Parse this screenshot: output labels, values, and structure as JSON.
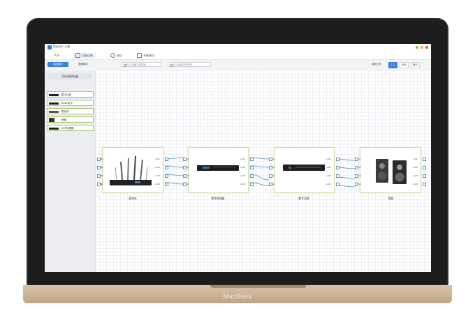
{
  "device": {
    "brand": "MacBook"
  },
  "app": {
    "title": "Digisyn 上线"
  },
  "tabs": [
    {
      "label": "A/A",
      "icon": "home-icon"
    },
    {
      "label": "设备连接",
      "icon": "wrench-icon"
    },
    {
      "label": "调试",
      "icon": "clock-icon"
    },
    {
      "label": "系统调试",
      "icon": "document-icon"
    }
  ],
  "toolbar": {
    "btn_primary": "添加模式",
    "btn_secondary": "查看模式",
    "search1_placeholder": "输入设备名称搜索",
    "search2_placeholder": "输入通道名称搜索",
    "zoom_label": "缩放比例",
    "zoom_options": [
      "1:1",
      "放大",
      "缩小"
    ]
  },
  "sidebar": {
    "title": "添加/删除设备",
    "items": [
      {
        "label": "数字功放"
      },
      {
        "label": "RAM-板卡"
      },
      {
        "label": "麦克风"
      },
      {
        "label": "音箱"
      },
      {
        "label": "DSP处理器"
      }
    ]
  },
  "nodes": [
    {
      "label": "麦克风",
      "ports_in": [
        "IN1",
        "IN2",
        "IN3",
        "IN4"
      ],
      "ports_out": [
        "out1",
        "out2",
        "out3",
        "out4"
      ]
    },
    {
      "label": "数字处理器",
      "ports_in": [
        "in1",
        "in2",
        "in3",
        "in4"
      ],
      "ports_out": [
        "out1",
        "out2",
        "out3",
        "out4"
      ]
    },
    {
      "label": "数字功放",
      "ports_in": [
        "in1",
        "in2",
        "in3",
        "in4"
      ],
      "ports_out": [
        "out1",
        "out2",
        "out3",
        "out4"
      ]
    },
    {
      "label": "音箱",
      "ports_in": [
        "in1",
        "in2",
        "in3",
        "in4"
      ],
      "ports_out": [
        "out1",
        "out2",
        "out3",
        "out4"
      ]
    }
  ],
  "colors": {
    "accent": "#3d7fe0",
    "node_border": "#cde0a3",
    "wire": "#5aa0d8"
  }
}
